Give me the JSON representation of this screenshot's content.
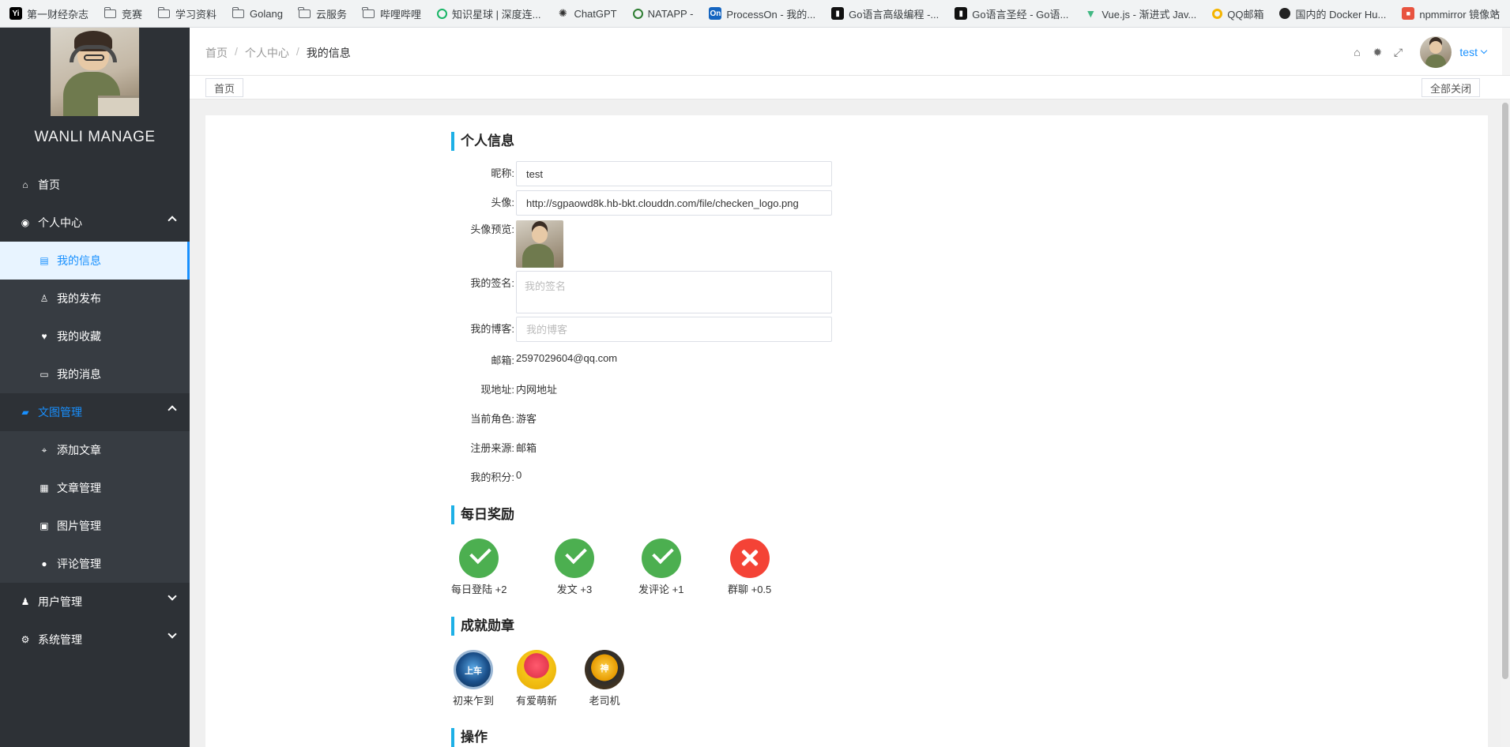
{
  "bookmarks": [
    {
      "label": "第一财经杂志",
      "icon": "yicai-icon",
      "type": "site"
    },
    {
      "label": "竞赛",
      "icon": "folder-icon",
      "type": "folder"
    },
    {
      "label": "学习资料",
      "icon": "folder-icon",
      "type": "folder"
    },
    {
      "label": "Golang",
      "icon": "folder-icon",
      "type": "folder"
    },
    {
      "label": "云服务",
      "icon": "folder-icon",
      "type": "folder"
    },
    {
      "label": "哔哩哔哩",
      "icon": "folder-icon",
      "type": "folder"
    },
    {
      "label": "知识星球 | 深度连...",
      "icon": "zsxq-icon",
      "type": "site"
    },
    {
      "label": "ChatGPT",
      "icon": "openai-icon",
      "type": "site"
    },
    {
      "label": "NATAPP -",
      "icon": "natapp-icon",
      "type": "site"
    },
    {
      "label": "ProcessOn - 我的...",
      "icon": "processon-icon",
      "type": "site"
    },
    {
      "label": "Go语言高级编程 -...",
      "icon": "book-icon",
      "type": "site"
    },
    {
      "label": "Go语言圣经 - Go语...",
      "icon": "book-icon",
      "type": "site"
    },
    {
      "label": "Vue.js - 渐进式 Jav...",
      "icon": "vue-icon",
      "type": "site"
    },
    {
      "label": "QQ邮箱",
      "icon": "qqmail-icon",
      "type": "site"
    },
    {
      "label": "国内的 Docker Hu...",
      "icon": "github-icon",
      "type": "site"
    },
    {
      "label": "npmmirror 镜像站",
      "icon": "npm-icon",
      "type": "site"
    }
  ],
  "sidebar": {
    "brand": "WANLI MANAGE",
    "items": [
      {
        "label": "首页",
        "icon": "home-icon"
      },
      {
        "label": "个人中心",
        "icon": "user-circle-icon"
      },
      {
        "label": "我的信息",
        "icon": "id-card-icon"
      },
      {
        "label": "我的发布",
        "icon": "user-plus-icon"
      },
      {
        "label": "我的收藏",
        "icon": "heart-icon"
      },
      {
        "label": "我的消息",
        "icon": "monitor-icon"
      },
      {
        "label": "文图管理",
        "icon": "book-icon"
      },
      {
        "label": "添加文章",
        "icon": "graduation-cap-icon"
      },
      {
        "label": "文章管理",
        "icon": "gift-icon"
      },
      {
        "label": "图片管理",
        "icon": "image-icon"
      },
      {
        "label": "评论管理",
        "icon": "comment-icon"
      },
      {
        "label": "用户管理",
        "icon": "male-icon"
      },
      {
        "label": "系统管理",
        "icon": "cogs-icon"
      }
    ]
  },
  "header": {
    "breadcrumb": [
      "首页",
      "个人中心",
      "我的信息"
    ],
    "username": "test"
  },
  "tags": {
    "home": "首页",
    "close_all": "全部关闭"
  },
  "profile": {
    "title": "个人信息",
    "nickname_label": "昵称:",
    "nickname_value": "test",
    "avatar_label": "头像:",
    "avatar_value": "http://sgpaowd8k.hb-bkt.clouddn.com/file/checken_logo.png",
    "preview_label": "头像预览:",
    "signature_label": "我的签名:",
    "signature_placeholder": "我的签名",
    "blog_label": "我的博客:",
    "blog_placeholder": "我的博客",
    "email_label": "邮箱:",
    "email_value": "2597029604@qq.com",
    "address_label": "现地址:",
    "address_value": "内网地址",
    "role_label": "当前角色:",
    "role_value": "游客",
    "source_label": "注册来源:",
    "source_value": "邮箱",
    "points_label": "我的积分:",
    "points_value": "0"
  },
  "rewards": {
    "title": "每日奖励",
    "items": [
      {
        "label": "每日登陆 +2",
        "done": true
      },
      {
        "label": "发文 +3",
        "done": true
      },
      {
        "label": "发评论 +1",
        "done": true
      },
      {
        "label": "群聊 +0.5",
        "done": false
      }
    ]
  },
  "badges": {
    "title": "成就勋章",
    "items": [
      {
        "label": "初来乍到",
        "glyph": "上车"
      },
      {
        "label": "有爱萌新",
        "glyph": ""
      },
      {
        "label": "老司机",
        "glyph": "神"
      }
    ]
  },
  "actions": {
    "title": "操作"
  },
  "colors": {
    "sidebar_bg": "#2d3136",
    "accent": "#1890ff",
    "section_bar": "#1eb0e6",
    "success": "#4caf50",
    "danger": "#f44336"
  }
}
